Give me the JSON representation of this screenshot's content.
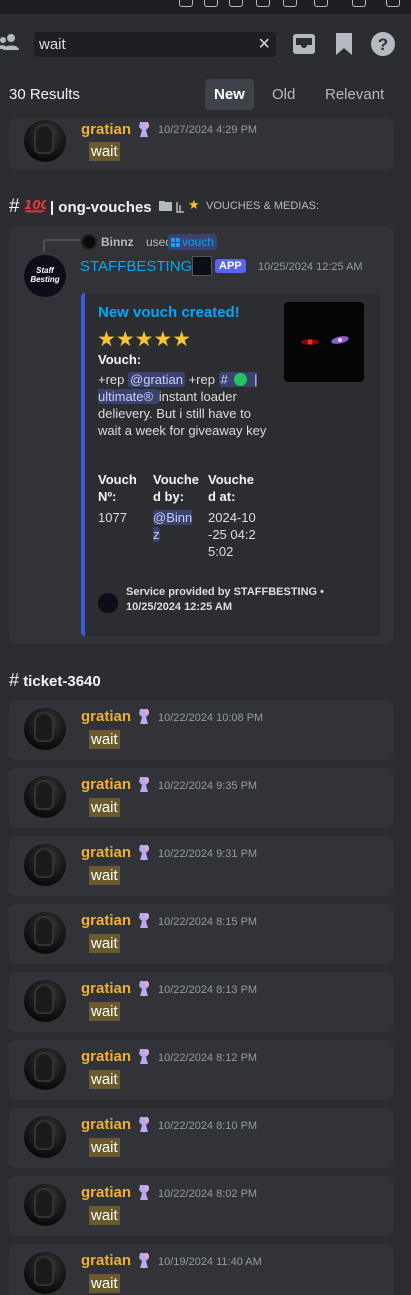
{
  "search": {
    "query": "wait"
  },
  "results": {
    "count_label": "30 Results",
    "sort_tabs": [
      {
        "label": "New",
        "active": true
      },
      {
        "label": "Old",
        "active": false
      },
      {
        "label": "Relevant",
        "active": false
      }
    ]
  },
  "first_result": {
    "author": "gratian",
    "timestamp": "10/27/2024 4:29 PM",
    "content": "wait"
  },
  "vouch_channel": {
    "name": "| ong-vouches",
    "category": "VOUCHES & MEDIAS:",
    "interaction_user": "Binnz",
    "interaction_used": "used",
    "interaction_command": "vouch",
    "bot_name": "STAFFBESTING",
    "app_tag": "APP",
    "timestamp": "10/25/2024 12:25 AM",
    "avatar_text": "Staff Besting",
    "embed": {
      "title": "New vouch created!",
      "stars": "★★★★★",
      "vouch_label": "Vouch:",
      "vouch_text_1": "+rep",
      "vouch_mention_user": "@gratian",
      "vouch_text_2": "+rep",
      "vouch_channel_mention": "ultimate®",
      "vouch_text_3": "instant loader delievery. But i still have to wait a week for giveaway key",
      "field1_name": "Vouch Nº:",
      "field1_value": "1077",
      "field2_name": "Vouched by:",
      "field2_value": "@Binnz",
      "field3_name": "Vouched at:",
      "field3_value": "2024-10-25 04:25:02",
      "footer": "Service provided by STAFFBESTING • 10/25/2024 12:25 AM"
    }
  },
  "ticket_channel": {
    "name": "ticket-3640",
    "messages": [
      {
        "author": "gratian",
        "timestamp": "10/22/2024 10:08 PM",
        "content": "wait"
      },
      {
        "author": "gratian",
        "timestamp": "10/22/2024 9:35 PM",
        "content": "wait"
      },
      {
        "author": "gratian",
        "timestamp": "10/22/2024 9:31 PM",
        "content": "wait"
      },
      {
        "author": "gratian",
        "timestamp": "10/22/2024 8:15 PM",
        "content": "wait"
      },
      {
        "author": "gratian",
        "timestamp": "10/22/2024 8:13 PM",
        "content": "wait"
      },
      {
        "author": "gratian",
        "timestamp": "10/22/2024 8:12 PM",
        "content": "wait"
      },
      {
        "author": "gratian",
        "timestamp": "10/22/2024 8:10 PM",
        "content": "wait"
      },
      {
        "author": "gratian",
        "timestamp": "10/22/2024 8:02 PM",
        "content": "wait"
      },
      {
        "author": "gratian",
        "timestamp": "10/19/2024 11:40 AM",
        "content": "wait"
      }
    ]
  },
  "colors": {
    "background": "#2b2d31",
    "card": "#313338",
    "username": "#f0b132",
    "link": "#00a8fc",
    "highlight": "#6b5a2e",
    "app_badge": "#5865f2"
  },
  "icons": [
    "members-icon",
    "close-icon",
    "inbox-icon",
    "bookmark-icon",
    "help-icon",
    "hash-icon",
    "hundred-emoji-icon",
    "folder-icon",
    "star-icon",
    "nitro-badge-icon",
    "slash-command-icon",
    "thread-hash-icon"
  ]
}
